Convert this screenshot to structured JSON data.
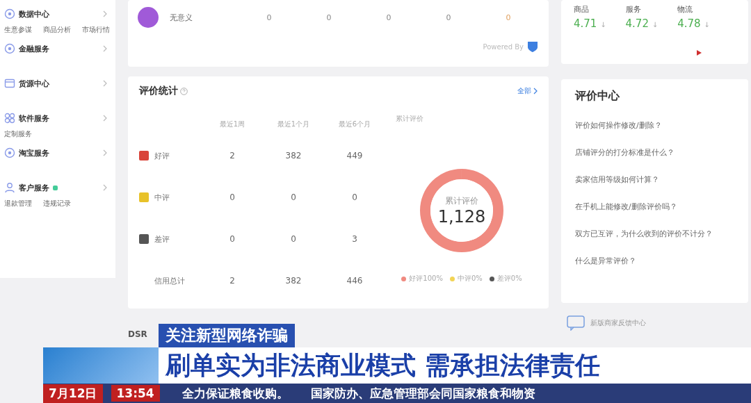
{
  "sidebar": {
    "items": [
      {
        "label": "数据中心",
        "kind": "circle",
        "subs": [
          "生意参谋",
          "商品分析",
          "市场行情"
        ]
      },
      {
        "label": "金融服务",
        "kind": "circle"
      },
      {
        "label": "货源中心",
        "kind": "window"
      },
      {
        "label": "软件服务",
        "kind": "grid",
        "subs": [
          "定制服务"
        ]
      },
      {
        "label": "淘宝服务",
        "kind": "circle"
      },
      {
        "label": "客户服务",
        "kind": "person",
        "badge": true,
        "subs": [
          "退款管理",
          "违规记录"
        ]
      }
    ]
  },
  "top_row": {
    "name": "无意义",
    "values": [
      "0",
      "0",
      "0",
      "0",
      "0"
    ],
    "powered_by": "Powered By"
  },
  "dsr": {
    "scores": [
      {
        "label": "商品",
        "value": "4.71",
        "arrow": "↓"
      },
      {
        "label": "服务",
        "value": "4.72",
        "arrow": "↓"
      },
      {
        "label": "物流",
        "value": "4.78",
        "arrow": "↓"
      }
    ]
  },
  "review_stats": {
    "title": "评价统计",
    "all_link": "全部",
    "columns": [
      "最近1周",
      "最近1个月",
      "最近6个月"
    ],
    "rows": [
      {
        "label": "好评",
        "color": "#d9443a",
        "values": [
          "2",
          "382",
          "449"
        ]
      },
      {
        "label": "中评",
        "color": "#e8c22a",
        "values": [
          "0",
          "0",
          "0"
        ]
      },
      {
        "label": "差评",
        "color": "#555555",
        "values": [
          "0",
          "0",
          "3"
        ]
      }
    ],
    "total": {
      "label": "信用总计",
      "values": [
        "2",
        "382",
        "446"
      ]
    },
    "cumulative_title": "累计评价",
    "center_label": "累计评价",
    "center_value": "1,128",
    "chart_data": {
      "type": "donut",
      "categories": [
        "好评",
        "中评",
        "差评"
      ],
      "values": [
        100,
        0,
        0
      ]
    },
    "legend": [
      {
        "share": "100%",
        "color": "#f08a80"
      },
      {
        "share": "0%",
        "color": "#f2d455"
      },
      {
        "share": "0%",
        "color": "#555555"
      }
    ]
  },
  "review_center": {
    "title": "评价中心",
    "links": [
      "评价如何操作修改/删除？",
      "店铺评分的打分标准是什么？",
      "卖家信用等级如何计算？",
      "在手机上能修改/删除评价吗？",
      "双方已互评，为什么收到的评价不计分？",
      "什么是异常评价？"
    ]
  },
  "footer": {
    "dsr_label": "DSR",
    "feedback": "新版商家反馈中心"
  },
  "news_caption": {
    "tag": "关注新型网络诈骗",
    "headline": "刷单实为非法商业模式 需承担法律责任",
    "date": "7月12日",
    "time": "13:54",
    "ticker": [
      "全力保证粮食收购。",
      "国家防办、应急管理部会同国家粮食和物资"
    ]
  }
}
